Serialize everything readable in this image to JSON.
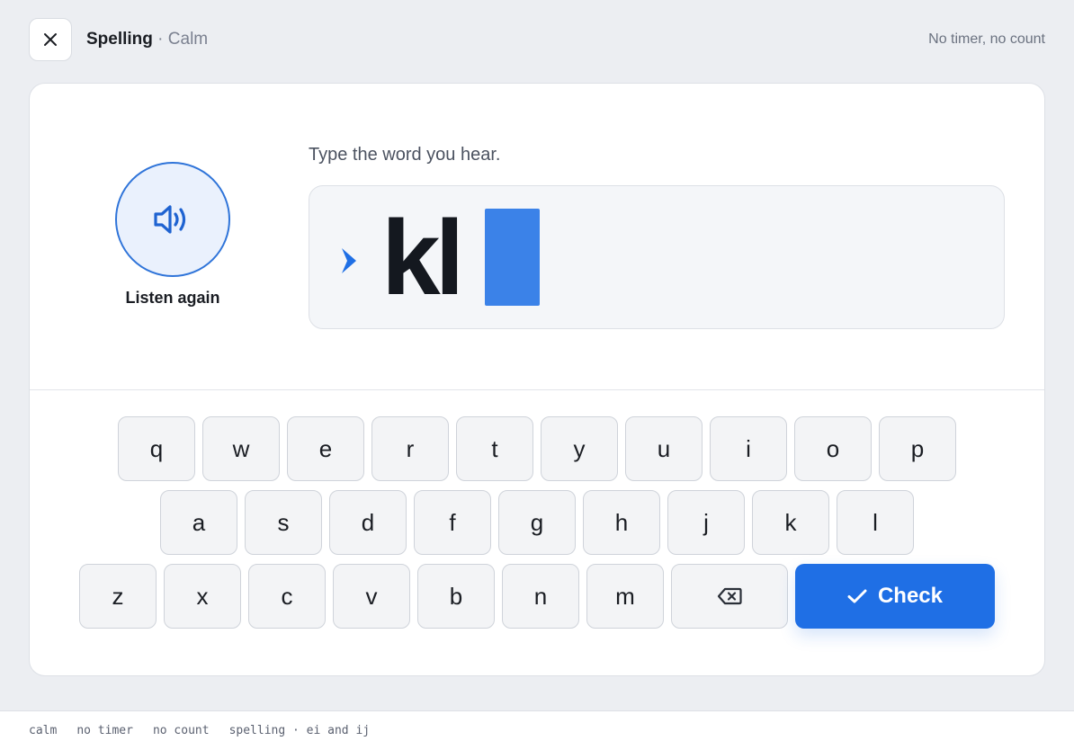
{
  "header": {
    "title": "Spelling",
    "separator": " · ",
    "mode": "Calm",
    "right_text": "No timer, no count"
  },
  "listen": {
    "label": "Listen again"
  },
  "prompt": "Type the word you hear.",
  "answer": {
    "typed": "kl"
  },
  "keyboard": {
    "row1": [
      "q",
      "w",
      "e",
      "r",
      "t",
      "y",
      "u",
      "i",
      "o",
      "p"
    ],
    "row2": [
      "a",
      "s",
      "d",
      "f",
      "g",
      "h",
      "j",
      "k",
      "l"
    ],
    "row3": [
      "z",
      "x",
      "c",
      "v",
      "b",
      "n",
      "m"
    ]
  },
  "check_label": "Check",
  "footer": {
    "items": [
      "calm",
      "no timer",
      "no count",
      "spelling · ei and ij"
    ]
  },
  "colors": {
    "accent": "#1f6fe5",
    "caret": "#3b82e8",
    "listen_bg": "#eaf1fd"
  },
  "icons": {
    "close": "close-icon",
    "speaker": "speaker-icon",
    "chevron": "chevron-right-icon",
    "backspace": "backspace-icon",
    "check": "checkmark-icon"
  }
}
